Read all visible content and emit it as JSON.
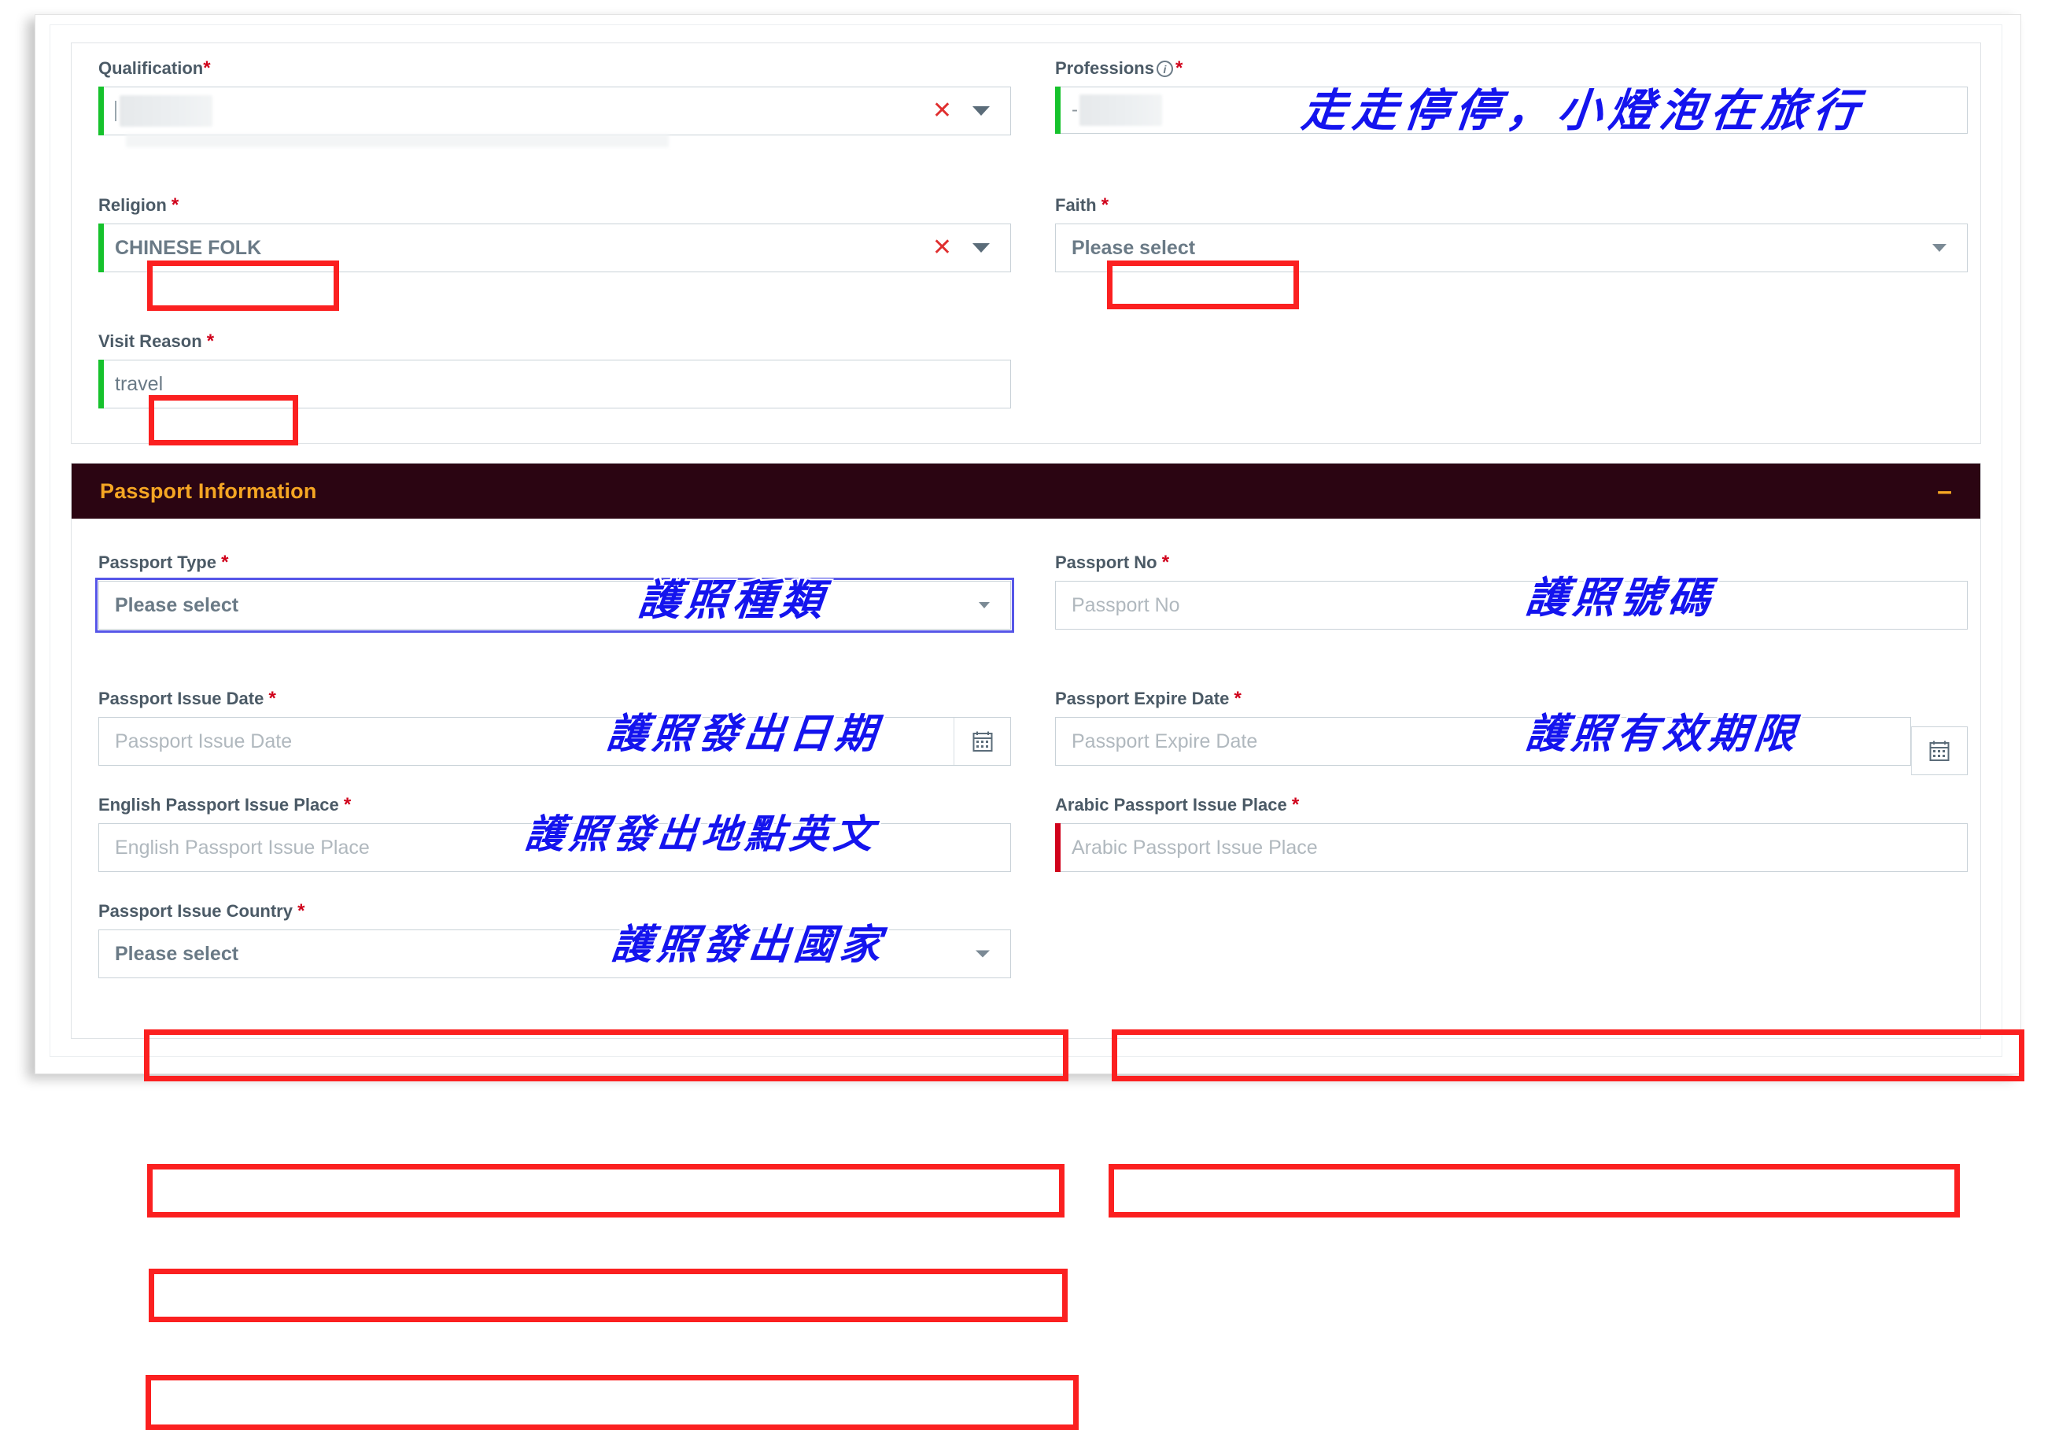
{
  "personal_section": {
    "fields": {
      "qualification": {
        "label": "Qualification",
        "required_mark": "*",
        "value": "",
        "state": "valid",
        "clear_icon": "close-x-icon",
        "dropdown_icon": "chevron-down-icon"
      },
      "professions": {
        "label": "Professions",
        "info_icon": "info-circle-icon",
        "required_mark": "*",
        "value": "",
        "state": "valid"
      },
      "religion": {
        "label": "Religion",
        "required_mark": "*",
        "value": "CHINESE FOLK",
        "state": "valid",
        "clear_icon": "close-x-icon",
        "dropdown_icon": "chevron-down-icon"
      },
      "faith": {
        "label": "Faith",
        "required_mark": "*",
        "value": "Please select",
        "dropdown_icon": "chevron-down-icon"
      },
      "visit_reason": {
        "label": "Visit Reason",
        "required_mark": "*",
        "value": "travel",
        "state": "valid"
      }
    }
  },
  "passport_section": {
    "header": {
      "title": "Passport Information",
      "collapse_symbol": "–",
      "collapse_icon": "minus-icon"
    },
    "fields": {
      "passport_type": {
        "label": "Passport Type",
        "required_mark": "*",
        "value": "Please select",
        "dropdown_icon": "chevron-down-icon"
      },
      "passport_no": {
        "label": "Passport No",
        "required_mark": "*",
        "placeholder": "Passport No",
        "value": ""
      },
      "passport_issue_date": {
        "label": "Passport Issue Date",
        "required_mark": "*",
        "placeholder": "Passport Issue Date",
        "value": "",
        "calendar_icon": "calendar-icon"
      },
      "passport_expire_date": {
        "label": "Passport Expire Date",
        "required_mark": "*",
        "placeholder": "Passport Expire Date",
        "value": "",
        "calendar_icon": "calendar-icon"
      },
      "english_passport_issue_place": {
        "label": "English Passport Issue Place",
        "required_mark": "*",
        "placeholder": "English Passport Issue Place",
        "value": ""
      },
      "arabic_passport_issue_place": {
        "label": "Arabic Passport Issue Place",
        "required_mark": "*",
        "placeholder": "Arabic Passport Issue Place",
        "value": "",
        "state": "invalid"
      },
      "passport_issue_country": {
        "label": "Passport Issue Country",
        "required_mark": "*",
        "value": "Please select",
        "dropdown_icon": "chevron-down-icon"
      }
    }
  },
  "annotations": {
    "watermark": "走走停停，小燈泡在旅行",
    "passport_type": "護照種類",
    "passport_no": "護照號碼",
    "issue_date": "護照發出日期",
    "expire_date": "護照有效期限",
    "english_issue_place": "護照發出地點英文",
    "issue_country": "護照發出國家"
  },
  "colors": {
    "annotation_red": "#fb2020",
    "annotation_blue": "#1414ee",
    "header_bg": "#2b0512",
    "header_text": "#f5a623",
    "valid_green": "#16c22c",
    "invalid_red": "#d0021b"
  }
}
